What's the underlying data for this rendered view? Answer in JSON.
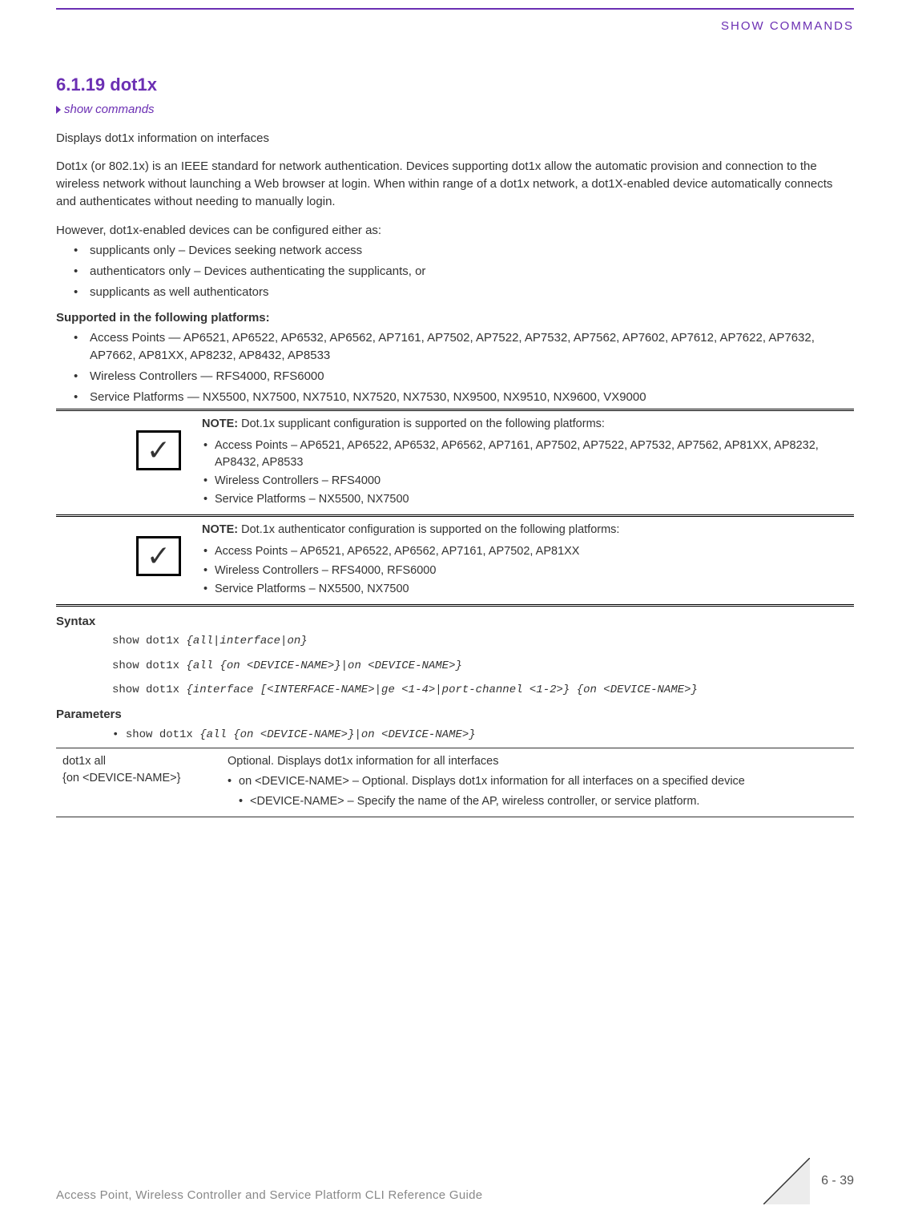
{
  "header": {
    "right": "SHOW COMMANDS"
  },
  "section": {
    "number_title": "6.1.19 dot1x",
    "breadcrumb": "show commands",
    "intro1": "Displays dot1x information on interfaces",
    "intro2": "Dot1x (or 802.1x) is an IEEE standard for network authentication. Devices supporting dot1x allow the automatic provision and connection to the wireless network without launching a Web browser at login. When within range of a dot1x network, a dot1X-enabled device automatically connects and authenticates without needing to manually login.",
    "intro3": "However, dot1x-enabled devices can be configured either as:",
    "config_list": [
      "supplicants only – Devices seeking network access",
      "authenticators only – Devices authenticating the supplicants, or",
      "supplicants as well authenticators"
    ],
    "supported_hdr": "Supported in the following platforms:",
    "supported_list": [
      "Access Points — AP6521, AP6522, AP6532, AP6562, AP7161, AP7502, AP7522, AP7532, AP7562, AP7602, AP7612, AP7622, AP7632, AP7662, AP81XX, AP8232, AP8432, AP8533",
      "Wireless Controllers — RFS4000, RFS6000",
      "Service Platforms — NX5500, NX7500, NX7510, NX7520, NX7530, NX9500, NX9510, NX9600, VX9000"
    ]
  },
  "notes": [
    {
      "title": "NOTE:",
      "lead": " Dot.1x supplicant configuration is supported on the following platforms:",
      "items": [
        "Access Points – AP6521, AP6522, AP6532, AP6562, AP7161, AP7502, AP7522, AP7532, AP7562, AP81XX, AP8232, AP8432, AP8533",
        "Wireless Controllers – RFS4000",
        "Service Platforms – NX5500, NX7500"
      ]
    },
    {
      "title": "NOTE:",
      "lead": " Dot.1x authenticator configuration is supported on the following platforms:",
      "items": [
        "Access Points – AP6521, AP6522, AP6562, AP7161, AP7502, AP81XX",
        "Wireless Controllers – RFS4000, RFS6000",
        "Service Platforms – NX5500, NX7500"
      ]
    }
  ],
  "syntax": {
    "hdr": "Syntax",
    "lines": [
      {
        "cmd": "show dot1x ",
        "args": "{all|interface|on}"
      },
      {
        "cmd": "show dot1x ",
        "args": "{all {on <DEVICE-NAME>}|on <DEVICE-NAME>}"
      },
      {
        "cmd": "show dot1x ",
        "args": "{interface [<INTERFACE-NAME>|ge <1-4>|port-channel <1-2>} {on <DEVICE-NAME>}"
      }
    ]
  },
  "parameters": {
    "hdr": "Parameters",
    "line": {
      "cmd": "show dot1x ",
      "args": "{all {on <DEVICE-NAME>}|on <DEVICE-NAME>}"
    },
    "table": {
      "left1": "dot1x all",
      "left2": "{on <DEVICE-NAME>}",
      "right_top": "Optional. Displays dot1x information for all interfaces",
      "right_b1": "on <DEVICE-NAME> – Optional. Displays dot1x information for all interfaces on a specified device",
      "right_b1a": "<DEVICE-NAME> – Specify the name of the AP, wireless controller, or service platform."
    }
  },
  "footer": {
    "left": "Access Point, Wireless Controller and Service Platform CLI Reference Guide",
    "page": "6 - 39"
  }
}
